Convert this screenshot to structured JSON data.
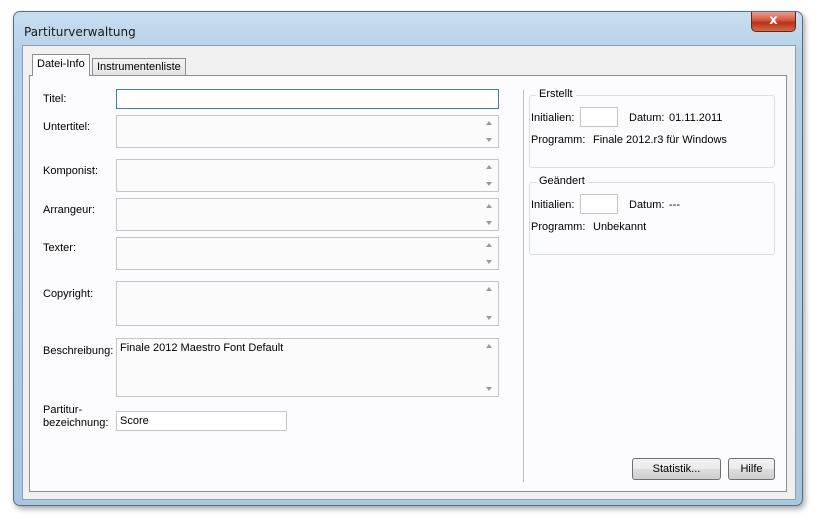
{
  "window": {
    "title": "Partiturverwaltung",
    "close_glyph": "x"
  },
  "tabs": [
    {
      "label": "Datei-Info",
      "active": true
    },
    {
      "label": "Instrumentenliste",
      "active": false
    }
  ],
  "fields": {
    "titel": {
      "label": "Titel:",
      "value": ""
    },
    "untertitel": {
      "label": "Untertitel:",
      "value": ""
    },
    "komponist": {
      "label": "Komponist:",
      "value": ""
    },
    "arrangeur": {
      "label": "Arrangeur:",
      "value": ""
    },
    "texter": {
      "label": "Texter:",
      "value": ""
    },
    "copyright": {
      "label": "Copyright:",
      "value": ""
    },
    "beschreibung": {
      "label": "Beschreibung:",
      "value": "Finale 2012 Maestro Font Default"
    },
    "partitur": {
      "label_line1": "Partitur-",
      "label_line2": "bezeichnung:",
      "value": "Score"
    }
  },
  "erstellt": {
    "title": "Erstellt",
    "initialien_label": "Initialien:",
    "initialien_value": "",
    "datum_label": "Datum:",
    "datum_value": "01.11.2011",
    "programm_label": "Programm:",
    "programm_value": "Finale 2012.r3 für Windows"
  },
  "geaendert": {
    "title": "Geändert",
    "initialien_label": "Initialien:",
    "initialien_value": "",
    "datum_label": "Datum:",
    "datum_value": "---",
    "programm_label": "Programm:",
    "programm_value": "Unbekannt"
  },
  "buttons": {
    "statistik": "Statistik...",
    "hilfe": "Hilfe"
  }
}
